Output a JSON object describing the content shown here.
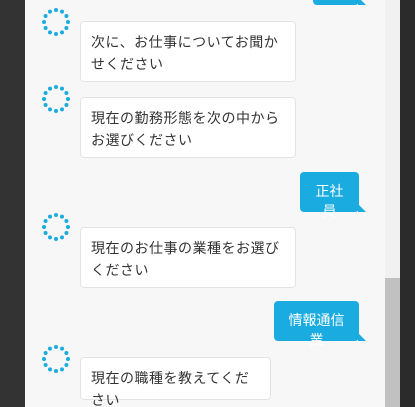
{
  "chat": {
    "messages": [
      {
        "sender": "bot",
        "text": "次に、お仕事についてお聞かせください"
      },
      {
        "sender": "bot",
        "text": "現在の勤務形態を次の中からお選びください"
      },
      {
        "sender": "user",
        "text": "正社員"
      },
      {
        "sender": "bot",
        "text": "現在のお仕事の業種をお選びください"
      },
      {
        "sender": "user",
        "text": "情報通信業"
      },
      {
        "sender": "bot",
        "text": "現在の職種を教えてください"
      }
    ]
  },
  "colors": {
    "user_bubble": "#1aace0",
    "bot_bubble": "#ffffff",
    "avatar_dots": "#1aace0"
  },
  "icons": {
    "avatar": "dotted-circle-icon"
  }
}
